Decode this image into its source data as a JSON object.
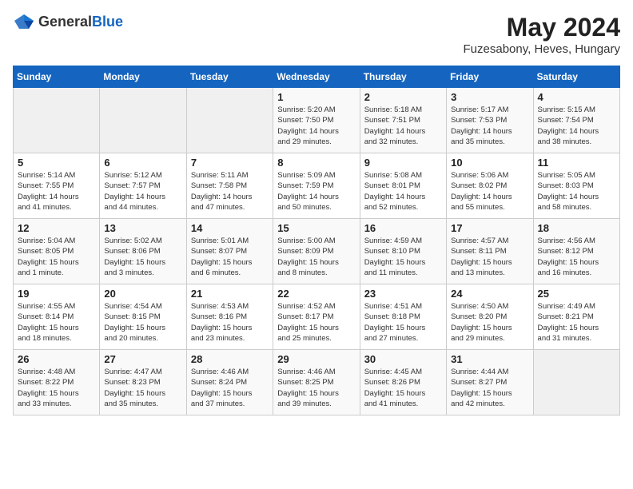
{
  "header": {
    "logo_general": "General",
    "logo_blue": "Blue",
    "title": "May 2024",
    "subtitle": "Fuzesabony, Heves, Hungary"
  },
  "days_of_week": [
    "Sunday",
    "Monday",
    "Tuesday",
    "Wednesday",
    "Thursday",
    "Friday",
    "Saturday"
  ],
  "weeks": [
    [
      {
        "day": "",
        "info": ""
      },
      {
        "day": "",
        "info": ""
      },
      {
        "day": "",
        "info": ""
      },
      {
        "day": "1",
        "info": "Sunrise: 5:20 AM\nSunset: 7:50 PM\nDaylight: 14 hours\nand 29 minutes."
      },
      {
        "day": "2",
        "info": "Sunrise: 5:18 AM\nSunset: 7:51 PM\nDaylight: 14 hours\nand 32 minutes."
      },
      {
        "day": "3",
        "info": "Sunrise: 5:17 AM\nSunset: 7:53 PM\nDaylight: 14 hours\nand 35 minutes."
      },
      {
        "day": "4",
        "info": "Sunrise: 5:15 AM\nSunset: 7:54 PM\nDaylight: 14 hours\nand 38 minutes."
      }
    ],
    [
      {
        "day": "5",
        "info": "Sunrise: 5:14 AM\nSunset: 7:55 PM\nDaylight: 14 hours\nand 41 minutes."
      },
      {
        "day": "6",
        "info": "Sunrise: 5:12 AM\nSunset: 7:57 PM\nDaylight: 14 hours\nand 44 minutes."
      },
      {
        "day": "7",
        "info": "Sunrise: 5:11 AM\nSunset: 7:58 PM\nDaylight: 14 hours\nand 47 minutes."
      },
      {
        "day": "8",
        "info": "Sunrise: 5:09 AM\nSunset: 7:59 PM\nDaylight: 14 hours\nand 50 minutes."
      },
      {
        "day": "9",
        "info": "Sunrise: 5:08 AM\nSunset: 8:01 PM\nDaylight: 14 hours\nand 52 minutes."
      },
      {
        "day": "10",
        "info": "Sunrise: 5:06 AM\nSunset: 8:02 PM\nDaylight: 14 hours\nand 55 minutes."
      },
      {
        "day": "11",
        "info": "Sunrise: 5:05 AM\nSunset: 8:03 PM\nDaylight: 14 hours\nand 58 minutes."
      }
    ],
    [
      {
        "day": "12",
        "info": "Sunrise: 5:04 AM\nSunset: 8:05 PM\nDaylight: 15 hours\nand 1 minute."
      },
      {
        "day": "13",
        "info": "Sunrise: 5:02 AM\nSunset: 8:06 PM\nDaylight: 15 hours\nand 3 minutes."
      },
      {
        "day": "14",
        "info": "Sunrise: 5:01 AM\nSunset: 8:07 PM\nDaylight: 15 hours\nand 6 minutes."
      },
      {
        "day": "15",
        "info": "Sunrise: 5:00 AM\nSunset: 8:09 PM\nDaylight: 15 hours\nand 8 minutes."
      },
      {
        "day": "16",
        "info": "Sunrise: 4:59 AM\nSunset: 8:10 PM\nDaylight: 15 hours\nand 11 minutes."
      },
      {
        "day": "17",
        "info": "Sunrise: 4:57 AM\nSunset: 8:11 PM\nDaylight: 15 hours\nand 13 minutes."
      },
      {
        "day": "18",
        "info": "Sunrise: 4:56 AM\nSunset: 8:12 PM\nDaylight: 15 hours\nand 16 minutes."
      }
    ],
    [
      {
        "day": "19",
        "info": "Sunrise: 4:55 AM\nSunset: 8:14 PM\nDaylight: 15 hours\nand 18 minutes."
      },
      {
        "day": "20",
        "info": "Sunrise: 4:54 AM\nSunset: 8:15 PM\nDaylight: 15 hours\nand 20 minutes."
      },
      {
        "day": "21",
        "info": "Sunrise: 4:53 AM\nSunset: 8:16 PM\nDaylight: 15 hours\nand 23 minutes."
      },
      {
        "day": "22",
        "info": "Sunrise: 4:52 AM\nSunset: 8:17 PM\nDaylight: 15 hours\nand 25 minutes."
      },
      {
        "day": "23",
        "info": "Sunrise: 4:51 AM\nSunset: 8:18 PM\nDaylight: 15 hours\nand 27 minutes."
      },
      {
        "day": "24",
        "info": "Sunrise: 4:50 AM\nSunset: 8:20 PM\nDaylight: 15 hours\nand 29 minutes."
      },
      {
        "day": "25",
        "info": "Sunrise: 4:49 AM\nSunset: 8:21 PM\nDaylight: 15 hours\nand 31 minutes."
      }
    ],
    [
      {
        "day": "26",
        "info": "Sunrise: 4:48 AM\nSunset: 8:22 PM\nDaylight: 15 hours\nand 33 minutes."
      },
      {
        "day": "27",
        "info": "Sunrise: 4:47 AM\nSunset: 8:23 PM\nDaylight: 15 hours\nand 35 minutes."
      },
      {
        "day": "28",
        "info": "Sunrise: 4:46 AM\nSunset: 8:24 PM\nDaylight: 15 hours\nand 37 minutes."
      },
      {
        "day": "29",
        "info": "Sunrise: 4:46 AM\nSunset: 8:25 PM\nDaylight: 15 hours\nand 39 minutes."
      },
      {
        "day": "30",
        "info": "Sunrise: 4:45 AM\nSunset: 8:26 PM\nDaylight: 15 hours\nand 41 minutes."
      },
      {
        "day": "31",
        "info": "Sunrise: 4:44 AM\nSunset: 8:27 PM\nDaylight: 15 hours\nand 42 minutes."
      },
      {
        "day": "",
        "info": ""
      }
    ]
  ]
}
